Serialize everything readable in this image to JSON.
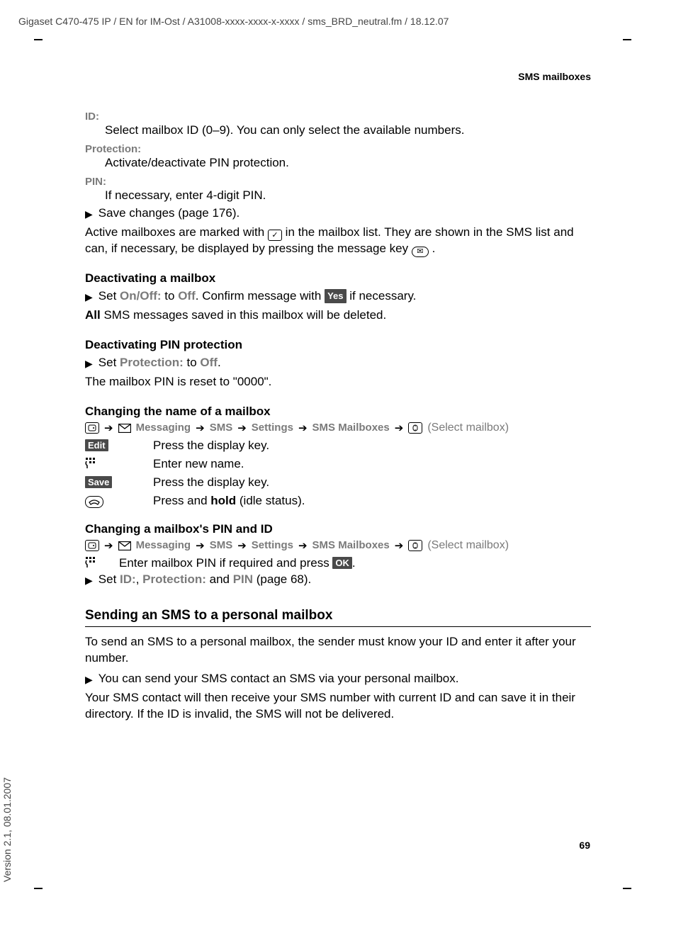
{
  "header": "Gigaset C470-475 IP / EN for IM-Ost / A31008-xxxx-xxxx-x-xxxx / sms_BRD_neutral.fm / 18.12.07",
  "section_header": "SMS mailboxes",
  "id_label": "ID:",
  "id_body": "Select mailbox ID (0–9). You can only select the available numbers.",
  "protection_label": "Protection:",
  "protection_body": "Activate/deactivate PIN protection.",
  "pin_label": "PIN:",
  "pin_body": "If necessary, enter 4-digit PIN.",
  "save_changes": "Save changes (page 176).",
  "active_mailboxes_1": "Active mailboxes are marked with ",
  "active_mailboxes_2": " in the mailbox list. They are shown in the SMS list and can, if necessary, be displayed by pressing the message key ",
  "period": ".",
  "deactivate_mb_head": "Deactivating a mailbox",
  "deactivate_set_1": "Set ",
  "deactivate_onoff": "On/Off:",
  "deactivate_to": " to ",
  "deactivate_off": "Off",
  "deactivate_confirm": ". Confirm message with ",
  "deactivate_yes": "Yes",
  "deactivate_ifnec": " if necessary.",
  "all_bold": "All",
  "all_rest": " SMS messages saved in this mailbox will be deleted.",
  "deactivate_pin_head": "Deactivating PIN protection",
  "deprot_set": "Set ",
  "deprot_protection": "Protection:",
  "deprot_to": " to ",
  "deprot_off": "Off",
  "deprot_period": ".",
  "pin_reset": "The mailbox PIN is reset to \"0000\".",
  "change_name_head": "Changing the name of a mailbox",
  "nav": {
    "messaging": "Messaging",
    "sms": "SMS",
    "settings": "Settings",
    "sms_mailboxes": "SMS Mailboxes",
    "select_mailbox": "(Select mailbox)"
  },
  "edit_key": "Edit",
  "edit_desc": "Press the display key.",
  "enter_name_desc": "Enter new name.",
  "save_key": "Save",
  "save_desc": "Press the display key.",
  "hold_1": "Press and ",
  "hold_bold": "hold",
  "hold_2": " (idle status).",
  "change_pin_head": "Changing a mailbox's PIN and ID",
  "enter_pin_1": "Enter mailbox PIN if required and press ",
  "ok_key": "OK",
  "set_fields_1": "Set ",
  "set_id": "ID:",
  "set_comma": ", ",
  "set_protection": "Protection:",
  "set_and": " and ",
  "set_pin": "PIN",
  "set_page": " (page 68).",
  "send_head": "Sending an SMS to a personal mailbox",
  "send_para1": "To send an SMS to a personal mailbox, the sender must know your ID and enter it after your number.",
  "send_bullet": "You can send your SMS contact an SMS via your personal mailbox.",
  "send_para2": "Your SMS contact will then receive your SMS number with current ID and can save it in their directory. If the ID is invalid, the SMS will not be delivered.",
  "page_number": "69",
  "version_side": "Version 2.1, 08.01.2007"
}
